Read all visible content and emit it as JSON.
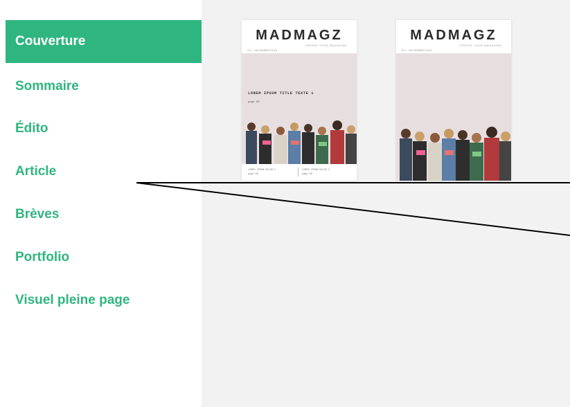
{
  "sidebar": {
    "items": [
      {
        "label": "Couverture",
        "active": true
      },
      {
        "label": "Sommaire"
      },
      {
        "label": "Édito"
      },
      {
        "label": "Article"
      },
      {
        "label": "Brèves"
      },
      {
        "label": "Portfolio"
      },
      {
        "label": "Visuel pleine page"
      }
    ]
  },
  "covers": [
    {
      "brand": "MADMAGZ",
      "tagline": "CREATE YOUR MAGAZINE",
      "issue": "N°1 · DECEMBER 2018",
      "title": "LOREM IPSUM TITLE TEXTE 1",
      "subtitle": "page 99",
      "footer_left": [
        "LOREM IPSUM DOLOR 2",
        "page 99"
      ],
      "footer_right": [
        "LOREM IPSUM DOLOR 3",
        "page 99"
      ]
    },
    {
      "brand": "MADMAGZ",
      "tagline": "CREATE YOUR MAGAZINE",
      "issue": "N°1 · DECEMBER 2018"
    }
  ],
  "colors": {
    "accent": "#2fb57f",
    "workspace": "#f2f2f2",
    "cover_background": "#e7dee0"
  }
}
